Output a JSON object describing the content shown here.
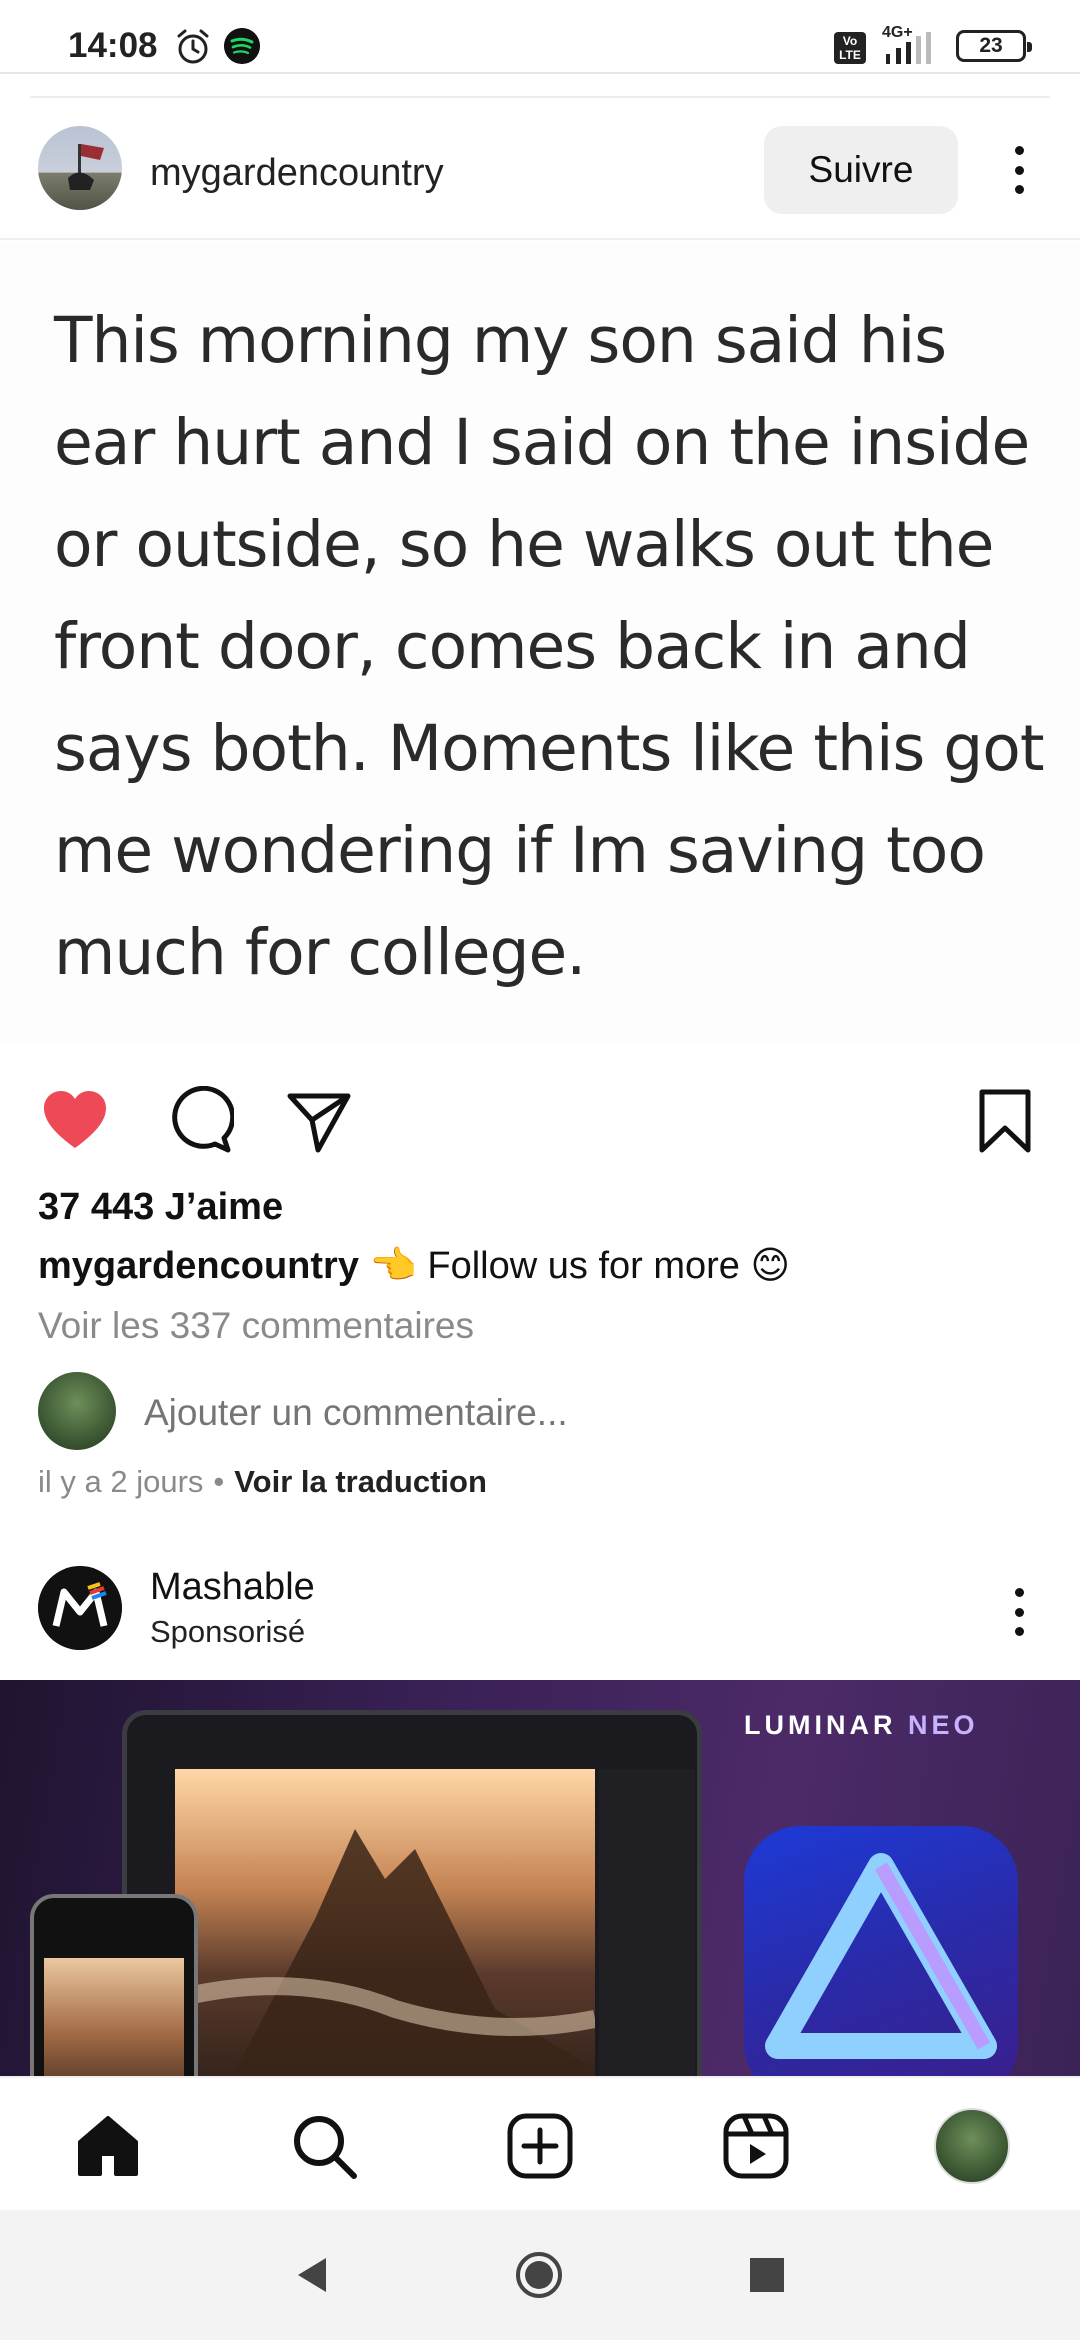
{
  "status_bar": {
    "time": "14:08",
    "network_label": "4G+",
    "volte_label": "Vo LTE",
    "battery": "23",
    "icons": [
      "alarm-icon",
      "spotify-icon",
      "volte-icon",
      "signal-icon",
      "battery-icon"
    ]
  },
  "post": {
    "username": "mygardencountry",
    "follow_label": "Suivre",
    "image_text": "This morning my son said his ear hurt and I said on the inside or outside, so he walks out the front door, comes back in and says both. Moments like this got me wondering if Im saving too much for college.",
    "actions": {
      "icons": [
        "heart-icon",
        "comment-icon",
        "share-icon",
        "bookmark-icon"
      ],
      "liked": true,
      "like_color": "#ed4956"
    },
    "likes": "37 443 J’aime",
    "caption_user": "mygardencountry",
    "caption_text": " 👈 Follow us for more 😊",
    "view_comments": "Voir les 337 commentaires",
    "add_comment_placeholder": "Ajouter un commentaire...",
    "time_ago": "il y a 2 jours",
    "separator": "•",
    "translate_link": "Voir la traduction"
  },
  "sponsored": {
    "name": "Mashable",
    "subtitle": "Sponsorisé",
    "ad": {
      "brand_main": "LUMINAR ",
      "brand_accent": "NEO"
    }
  },
  "bottom_nav": {
    "items": [
      "home-icon",
      "search-icon",
      "create-icon",
      "reels-icon",
      "profile-avatar"
    ]
  },
  "system_nav": {
    "items": [
      "back-icon",
      "home-circle-icon",
      "recents-icon"
    ]
  }
}
